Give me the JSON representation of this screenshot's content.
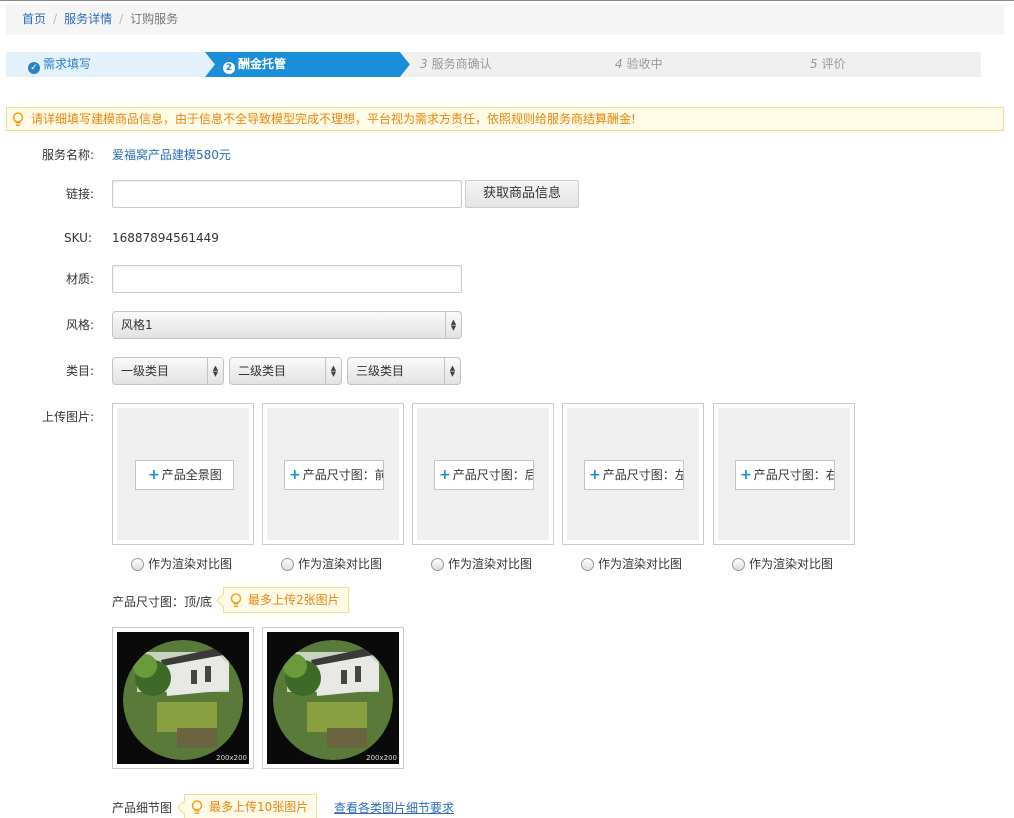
{
  "breadcrumb": {
    "home": "首页",
    "detail": "服务详情",
    "current": "订购服务",
    "sep": "/"
  },
  "steps": [
    {
      "num": "",
      "label": "需求填写",
      "state": "done"
    },
    {
      "num": "2",
      "label": "酬金托管",
      "state": "active"
    },
    {
      "num": "3",
      "label": "服务商确认",
      "state": "todo"
    },
    {
      "num": "4",
      "label": "验收中",
      "state": "todo"
    },
    {
      "num": "5",
      "label": "评价",
      "state": "todo"
    }
  ],
  "step_check": "✓",
  "notice": "请详细填写建模商品信息，由于信息不全导致模型完成不理想，平台视为需求方责任，依照规则给服务商结算酬金!",
  "form": {
    "service_name_label": "服务名称:",
    "service_name_value": "爱福窝产品建模580元",
    "link_label": "链接:",
    "link_value": "",
    "fetch_button": "获取商品信息",
    "sku_label": "SKU:",
    "sku_value": "16887894561449",
    "material_label": "材质:",
    "material_value": "",
    "style_label": "风格:",
    "style_value": "风格1",
    "category_label": "类目:",
    "category1": "一级类目",
    "category2": "二级类目",
    "category3": "三级类目",
    "upload_label": "上传图片:",
    "arrow_up": "▲",
    "arrow_down": "▼"
  },
  "upload_slots": [
    {
      "label": "产品全景图"
    },
    {
      "label": "产品尺寸图：前"
    },
    {
      "label": "产品尺寸图：后"
    },
    {
      "label": "产品尺寸图：左"
    },
    {
      "label": "产品尺寸图：右"
    }
  ],
  "plus": "+",
  "radio_label": "作为渲染对比图",
  "topbottom": {
    "label": "产品尺寸图：顶/底",
    "tip": "最多上传2张图片",
    "thumb_size": "200x200"
  },
  "detail": {
    "label": "产品细节图",
    "tip": "最多上传10张图片",
    "link": "查看各类图片细节要求"
  },
  "colors": {
    "accent": "#1a8fd9",
    "link": "#2a6db8",
    "warning": "#e8850c",
    "warning_bg": "#fffbe6"
  }
}
